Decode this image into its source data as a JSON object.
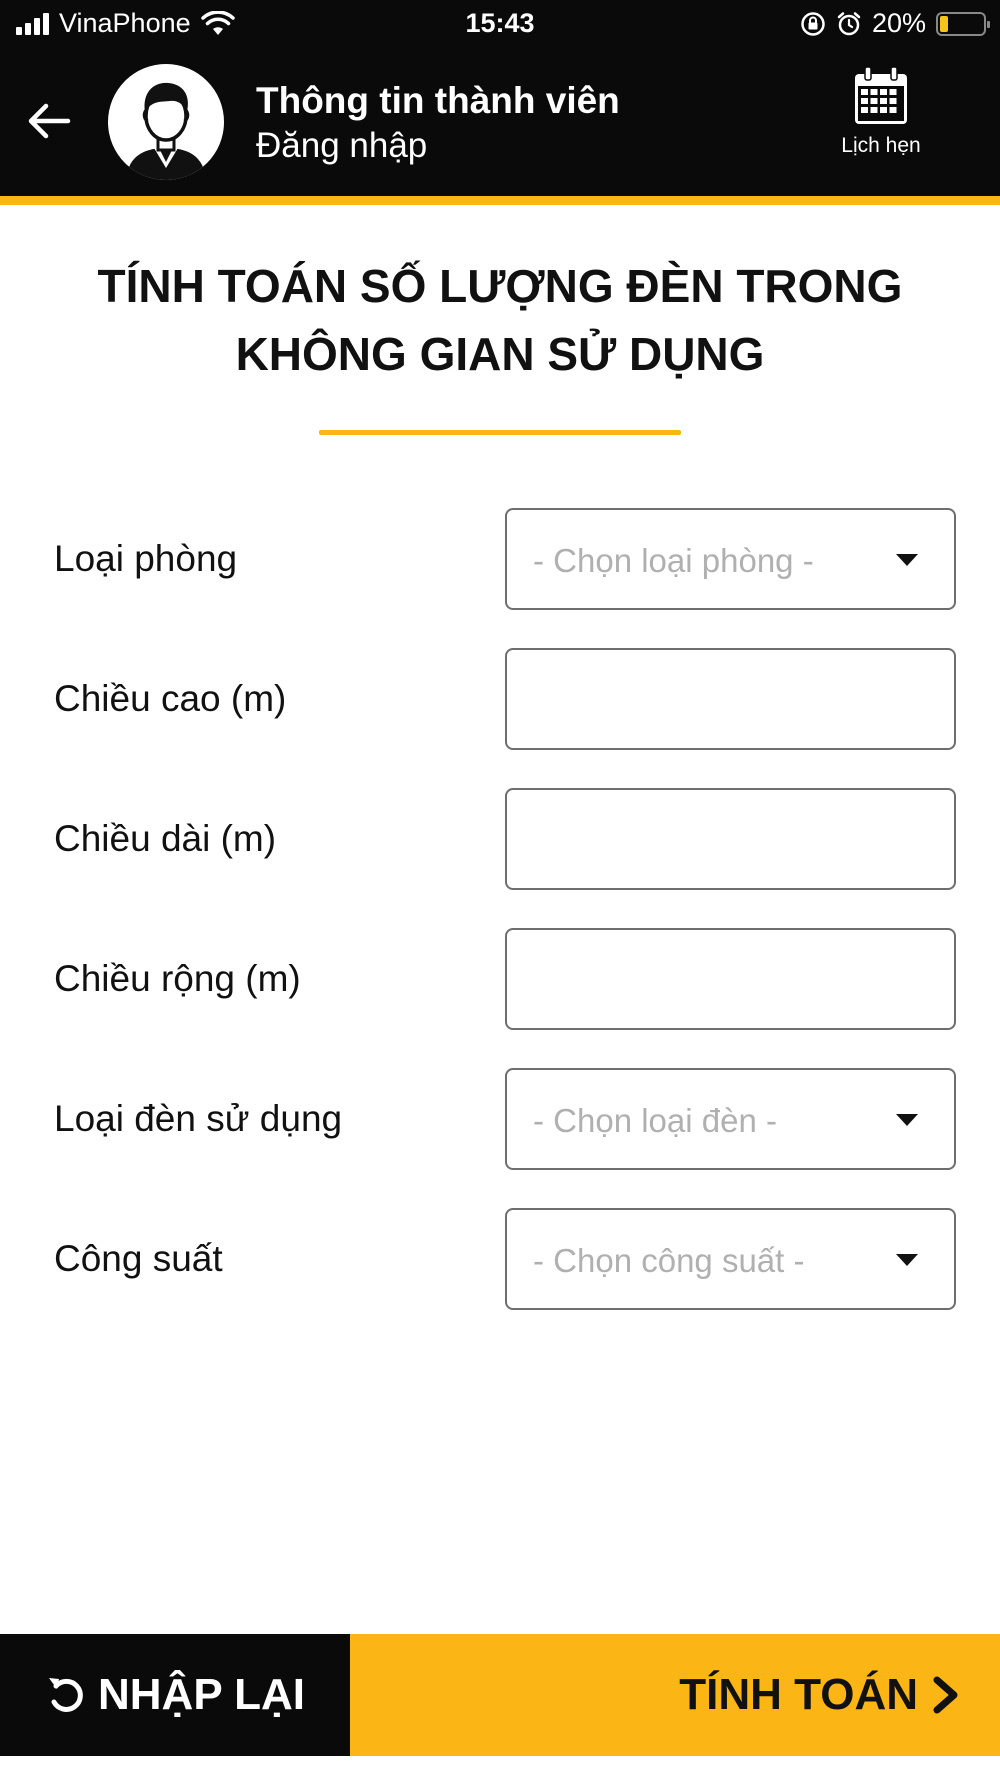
{
  "status_bar": {
    "carrier": "VinaPhone",
    "time": "15:43",
    "battery_percent": "20%",
    "battery_level": 0.2,
    "icons": [
      "signal-icon",
      "wifi-icon",
      "orientation-lock-icon",
      "alarm-icon",
      "battery-icon"
    ]
  },
  "header": {
    "title": "Thông tin thành viên",
    "subtitle": "Đăng nhập",
    "schedule_label": "Lịch hẹn",
    "icons": [
      "back-arrow-icon",
      "user-avatar-icon",
      "calendar-icon"
    ]
  },
  "page": {
    "title": "TÍNH TOÁN SỐ LƯỢNG ĐÈN TRONG KHÔNG GIAN SỬ DỤNG"
  },
  "form": {
    "room_type": {
      "label": "Loại phòng",
      "placeholder": "- Chọn loại phòng -"
    },
    "height": {
      "label": "Chiều cao (m)",
      "value": ""
    },
    "length": {
      "label": "Chiều dài (m)",
      "value": ""
    },
    "width": {
      "label": "Chiều rộng (m)",
      "value": ""
    },
    "lamp_type": {
      "label": "Loại đèn sử dụng",
      "placeholder": "- Chọn loại đèn -"
    },
    "power": {
      "label": "Công suất",
      "placeholder": "- Chọn công suất -"
    }
  },
  "actions": {
    "reset_label": "NHẬP LẠI",
    "calculate_label": "TÍNH TOÁN"
  },
  "colors": {
    "header_bg": "#0a0a0a",
    "accent": "#fbb515",
    "text": "#111111",
    "placeholder": "#b0b0b0"
  }
}
